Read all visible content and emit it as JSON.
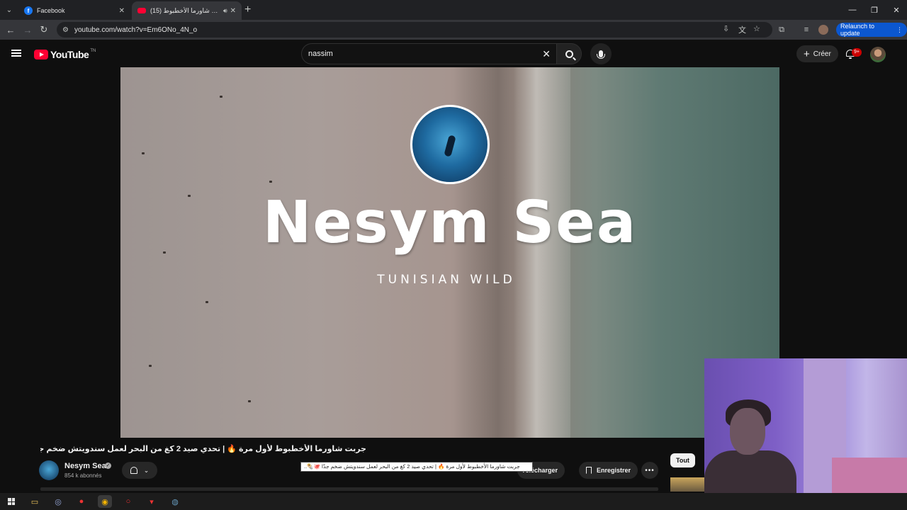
{
  "browser": {
    "tabs": [
      {
        "title": "Facebook",
        "favicon": "facebook-icon",
        "active": false
      },
      {
        "title": "جربت شاورما الأخطبوط (15)",
        "favicon": "youtube-icon",
        "active": true,
        "audio": true
      }
    ],
    "url": "youtube.com/watch?v=Em6ONo_4N_o",
    "relaunch_label": "Relaunch to update"
  },
  "youtube": {
    "logo_text": "YouTube",
    "country_code": "TN",
    "search_query": "nassim",
    "create_label": "Créer",
    "notification_count": "9+"
  },
  "video": {
    "art_title": "Nesym Sea",
    "art_subtitle": "TUNISIAN WILD",
    "title": "جربت شاورما الأخطبوط لأول مرة 🔥 | تحدي صيد 2 كغ من البحر لعمل سندويتش ضخم جدًا 🐙🌯..",
    "tooltip": "جربت شاورما الأخطبوط لأول مرة 🔥 | تحدي صيد 2 كغ من البحر لعمل سندويتش ضخم جدًا 🐙🌯..",
    "channel_name": "Nesym Sea",
    "subscribers": "854 k abonnés",
    "download_label": "Télécharger",
    "save_label": "Enregistrer",
    "chip_all": "Tout"
  },
  "colors": {
    "accent_red": "#ff0033",
    "relaunch_blue": "#0b57d0",
    "background": "#0f0f0f"
  }
}
